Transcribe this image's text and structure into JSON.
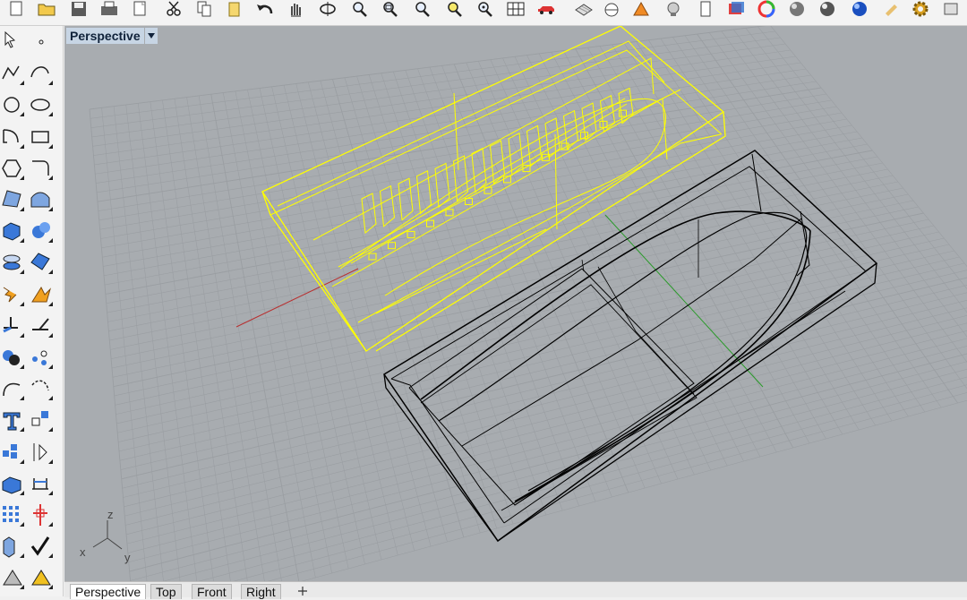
{
  "toolbar": {
    "icons": [
      "new-file-icon",
      "open-folder-icon",
      "save-icon",
      "print-icon",
      "template-icon",
      "cut-icon",
      "copy-icon",
      "paste-icon",
      "undo-icon",
      "pan-icon",
      "rotate-view-icon",
      "zoom-icon",
      "zoom-window-icon",
      "zoom-extents-icon",
      "zoom-selected-icon",
      "zoom-target-icon",
      "grid-icon",
      "car-icon",
      "layer-icon",
      "snap-icon",
      "osnap-icon",
      "light-icon",
      "clipboard-icon",
      "render-icon",
      "color-wheel-icon",
      "shaded-sphere-icon",
      "rendered-sphere-icon",
      "blue-sphere-icon",
      "paint-icon",
      "options-gear-icon",
      "more-icon"
    ]
  },
  "left_toolbar": {
    "icons": [
      "select-arrow-icon",
      "point-icon",
      "polyline-icon",
      "curve-icon",
      "circle-icon",
      "ellipse-icon",
      "arc-icon",
      "rectangle-icon",
      "polygon-icon",
      "fillet-curve-icon",
      "surface-patch-icon",
      "surface-loft-icon",
      "box-solid-icon",
      "sphere-solid-icon",
      "cylinder-icon",
      "mesh-icon",
      "explode-icon",
      "boolean-icon",
      "trim-icon",
      "split-icon",
      "group-icon",
      "point-cloud-icon",
      "curve-edit-icon",
      "curve-control-icon",
      "text-icon",
      "transform-icon",
      "array-icon",
      "mirror-icon",
      "solid-tools-icon",
      "dimension-icon",
      "grid-array-icon",
      "gumball-icon",
      "analyze-icon",
      "check-icon",
      "drafting-icon",
      "render-tools-icon"
    ]
  },
  "viewport": {
    "title": "Perspective",
    "axis": {
      "z": "z",
      "x": "x",
      "y": "y"
    },
    "colors": {
      "background": "#a8acb0",
      "grid": "#9a9ea2",
      "selected": "#ffff00",
      "object": "#000000",
      "x_axis": "#b83030",
      "y_axis": "#2a9a2a"
    }
  },
  "tabs": [
    {
      "label": "Perspective",
      "active": true
    },
    {
      "label": "Top",
      "active": false
    },
    {
      "label": "Front",
      "active": false
    },
    {
      "label": "Right",
      "active": false
    }
  ],
  "add_tab_icon": "plus-icon"
}
